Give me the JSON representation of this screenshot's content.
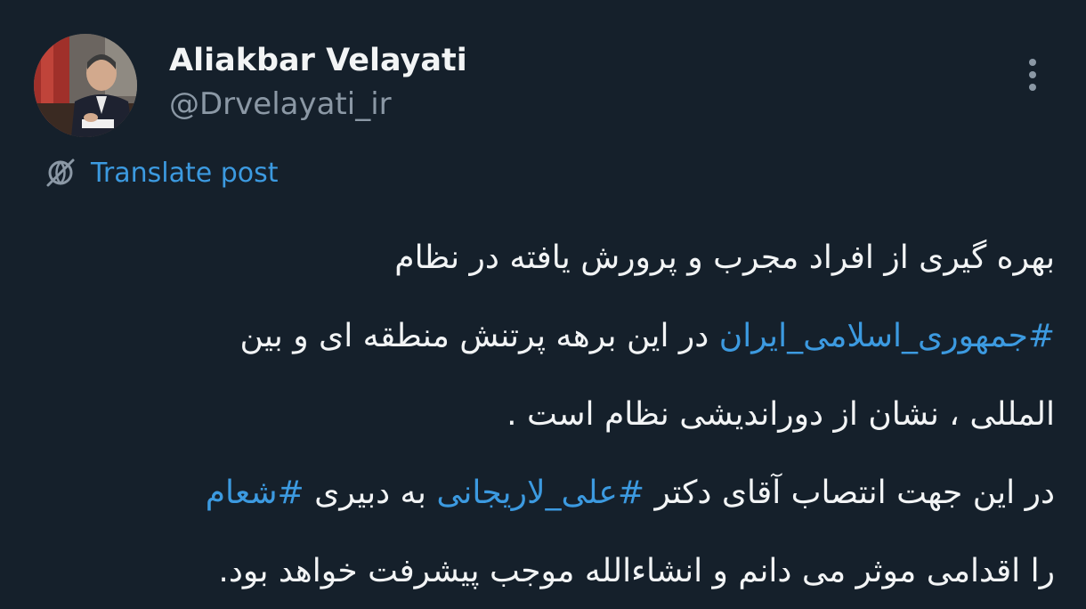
{
  "author": {
    "display_name": "Aliakbar Velayati",
    "handle": "@Drvelayati_ir"
  },
  "menu": {
    "icon": "more-vertical-icon"
  },
  "translate": {
    "icon": "translate-globe-icon",
    "label": "Translate post"
  },
  "post": {
    "lines": [
      {
        "segments": [
          {
            "text": "بهره گیری از افراد مجرب و پرورش یافته در نظام",
            "hashtag": false
          }
        ]
      },
      {
        "segments": [
          {
            "text": "#جمهوری_اسلامی_ایران",
            "hashtag": true
          },
          {
            "text": " در این برهه پرتنش منطقه ای و بین",
            "hashtag": false
          }
        ]
      },
      {
        "segments": [
          {
            "text": "المللی ، نشان از دوراندیشی نظام است .",
            "hashtag": false
          }
        ]
      },
      {
        "segments": [
          {
            "text": "در این جهت انتصاب آقای دکتر ",
            "hashtag": false
          },
          {
            "text": "#علی_لاریجانی",
            "hashtag": true
          },
          {
            "text": " به دبیری ",
            "hashtag": false
          },
          {
            "text": "#شعام",
            "hashtag": true
          }
        ]
      },
      {
        "segments": [
          {
            "text": "را اقدامی موثر می دانم و انشاءالله موجب پیشرفت خواهد بود.",
            "hashtag": false
          }
        ]
      }
    ]
  },
  "colors": {
    "background": "#15202b",
    "primary_text": "#f2f4f5",
    "secondary_text": "#8b98a5",
    "link": "#3c9ae0"
  }
}
